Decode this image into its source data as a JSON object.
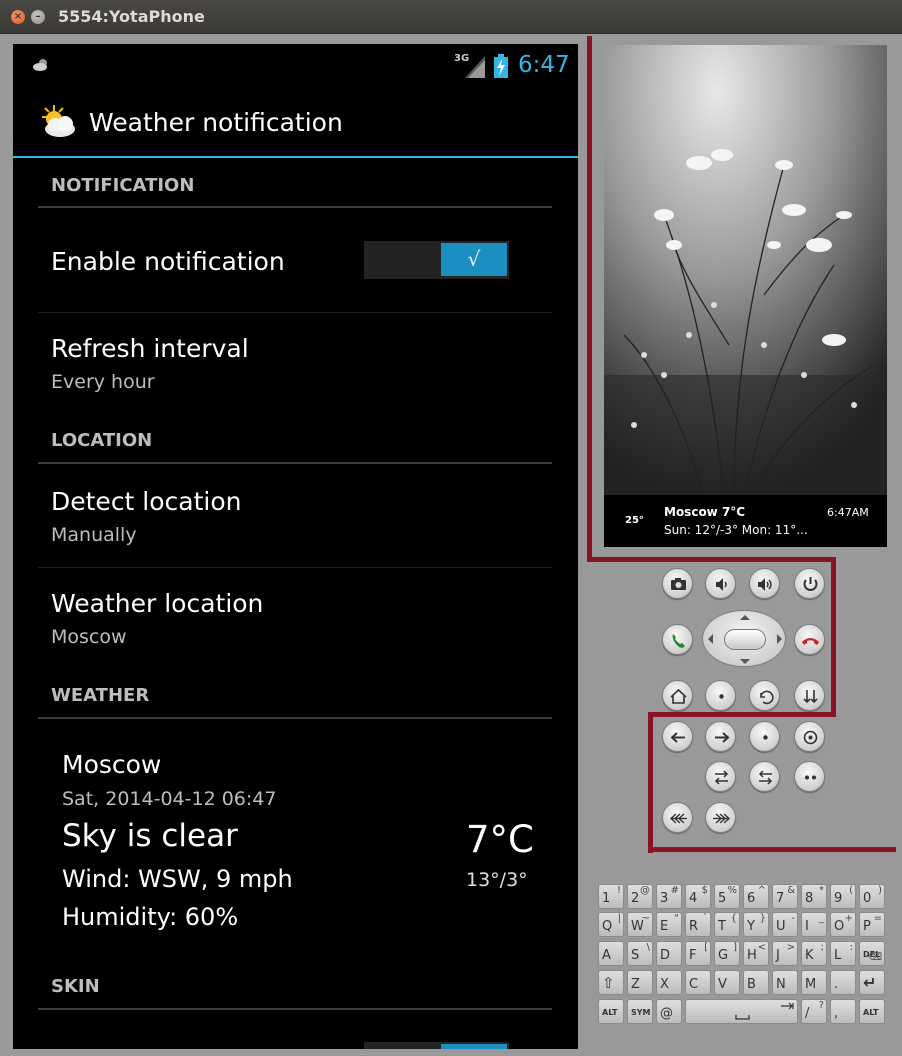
{
  "window": {
    "title": "5554:YotaPhone",
    "close_icon": "×",
    "minimize_icon": "–"
  },
  "statusbar": {
    "network": "3G",
    "time": "6:47"
  },
  "app": {
    "title": "Weather notification"
  },
  "sections": {
    "notification": "NOTIFICATION",
    "location": "LOCATION",
    "weather": "WEATHER",
    "skin": "SKIN"
  },
  "prefs": {
    "enable_notification": {
      "title": "Enable notification",
      "checked": true,
      "check_glyph": "√"
    },
    "refresh_interval": {
      "title": "Refresh interval",
      "summary": "Every hour"
    },
    "detect_location": {
      "title": "Detect location",
      "summary": "Manually"
    },
    "weather_location": {
      "title": "Weather location",
      "summary": "Moscow"
    }
  },
  "weather": {
    "city": "Moscow",
    "datetime": "Sat, 2014-04-12 06:47",
    "condition": "Sky is clear",
    "wind": "Wind: WSW, 9 mph",
    "humidity": "Humidity: 60%",
    "temperature": "7°C",
    "high_low": "13°/3°"
  },
  "yota_widget": {
    "temp_small": "25°",
    "city_temp": "Moscow 7°C",
    "forecast": "Sun: 12°/-3° Mon: 11°...",
    "time": "6:47AM"
  },
  "emulator_buttons": {
    "row1": [
      "camera-icon",
      "volume-down-icon",
      "volume-up-icon",
      "power-icon"
    ],
    "row2": [
      "call-icon",
      "dpad",
      "end-call-icon"
    ],
    "row3": [
      "home-icon",
      "dot-icon",
      "back-icon",
      "arrows-down-icon"
    ],
    "row4": [
      "arrow-left-icon",
      "arrow-right-icon",
      "dot-icon",
      "target-icon"
    ],
    "row5": [
      "swap-icon",
      "swap-icon",
      "double-dot-icon"
    ],
    "row6": [
      "rewind-icon",
      "fast-forward-icon"
    ]
  },
  "keyboard": {
    "rows": [
      [
        [
          "1",
          "!"
        ],
        [
          "2",
          "@"
        ],
        [
          "3",
          "#"
        ],
        [
          "4",
          "$"
        ],
        [
          "5",
          "%"
        ],
        [
          "6",
          "^"
        ],
        [
          "7",
          "&"
        ],
        [
          "8",
          "*"
        ],
        [
          "9",
          "("
        ],
        [
          "0",
          ")"
        ]
      ],
      [
        [
          "Q",
          "|"
        ],
        [
          "W",
          "~"
        ],
        [
          "E",
          "\""
        ],
        [
          "R",
          "`"
        ],
        [
          "T",
          "{"
        ],
        [
          "Y",
          "}"
        ],
        [
          "U",
          "-"
        ],
        [
          "I",
          "_"
        ],
        [
          "O",
          "+"
        ],
        [
          "P",
          "="
        ]
      ],
      [
        [
          "A",
          ""
        ],
        [
          "S",
          "\\"
        ],
        [
          "D",
          ""
        ],
        [
          "F",
          "["
        ],
        [
          "G",
          "]"
        ],
        [
          "H",
          "<"
        ],
        [
          "J",
          ">"
        ],
        [
          "K",
          ";"
        ],
        [
          "L",
          ":"
        ],
        [
          "DEL",
          "⌫"
        ]
      ],
      [
        [
          "⇧",
          ""
        ],
        [
          "Z",
          ""
        ],
        [
          "X",
          ""
        ],
        [
          "C",
          ""
        ],
        [
          "V",
          ""
        ],
        [
          "B",
          ""
        ],
        [
          "N",
          ""
        ],
        [
          "M",
          ""
        ],
        [
          ".",
          ""
        ],
        [
          "↵",
          ""
        ]
      ],
      [
        [
          "ALT",
          ""
        ],
        [
          "SYM",
          ""
        ],
        [
          "@",
          ""
        ],
        [
          "",
          ""
        ],
        [
          "/",
          "?"
        ],
        [
          ",",
          ""
        ],
        [
          "ALT",
          ""
        ]
      ]
    ]
  },
  "colors": {
    "accent": "#33b5e5",
    "toggle_on": "#1c8fc1",
    "frame_red": "#8a1326"
  }
}
